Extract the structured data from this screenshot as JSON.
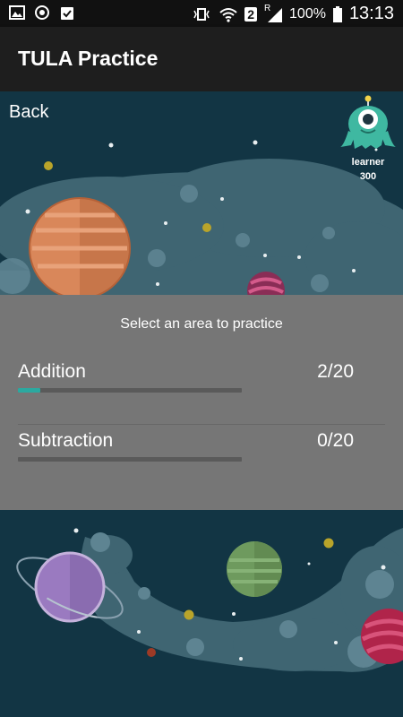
{
  "status_bar": {
    "signal_badge": "2",
    "roaming": "R",
    "battery": "100%",
    "time": "13:13"
  },
  "toolbar": {
    "title": "TULA Practice"
  },
  "nav": {
    "back_label": "Back"
  },
  "profile": {
    "name": "learner",
    "score": "300"
  },
  "panel": {
    "title": "Select an area to practice",
    "areas": [
      {
        "name": "Addition",
        "progress": "2/20",
        "fraction": 0.1
      },
      {
        "name": "Subtraction",
        "progress": "0/20",
        "fraction": 0.0
      }
    ]
  },
  "colors": {
    "space_bg": "#123544",
    "cloud": "#3f6572",
    "panel_bg": "#767676",
    "progress_fill": "#2ba9a0",
    "progress_track": "#5a5a5a"
  }
}
